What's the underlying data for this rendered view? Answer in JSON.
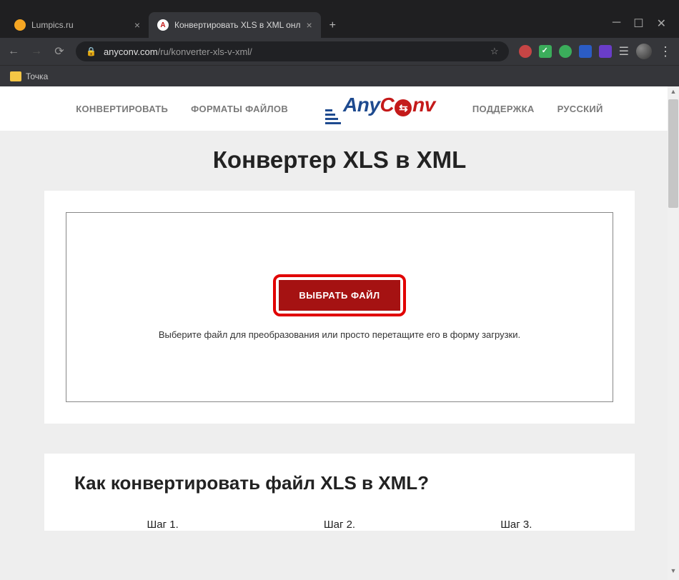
{
  "tabs": [
    {
      "title": "Lumpics.ru",
      "active": false,
      "favicon_color": "#f5a623"
    },
    {
      "title": "Конвертировать XLS в XML онл",
      "active": true,
      "favicon_color": "#c41a1a",
      "favicon_letter": "A"
    }
  ],
  "url": {
    "domain": "anyconv.com",
    "path": "/ru/konverter-xls-v-xml/"
  },
  "bookmarks": {
    "item1": "Точка"
  },
  "nav": {
    "convert": "КОНВЕРТИРОВАТЬ",
    "formats": "ФОРМАТЫ ФАЙЛОВ",
    "support": "ПОДДЕРЖКА",
    "lang": "РУССКИЙ"
  },
  "logo": {
    "part1": "Any",
    "part2": "C",
    "part3": "nv"
  },
  "page": {
    "heading": "Конвертер XLS в XML",
    "select_button": "ВЫБРАТЬ ФАЙЛ",
    "hint": "Выберите файл для преобразования или просто перетащите его в форму загрузки.",
    "how_heading": "Как конвертировать файл XLS в XML?",
    "steps": [
      "Шаг 1.",
      "Шаг 2.",
      "Шаг 3."
    ]
  }
}
